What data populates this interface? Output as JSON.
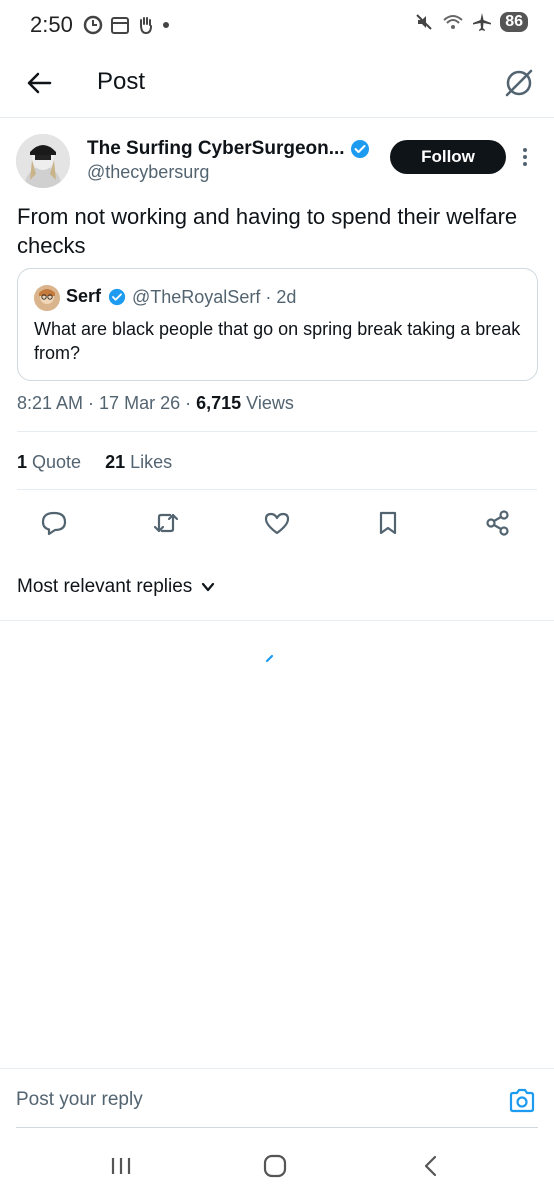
{
  "status_bar": {
    "time": "2:50",
    "battery": "86",
    "signal_label": "5"
  },
  "header": {
    "title": "Post"
  },
  "tweet": {
    "author_name": "The Surfing CyberSurgeon...",
    "author_handle": "@thecybersurg",
    "follow_label": "Follow",
    "text": "From not working and having to spend their welfare checks",
    "time": "8:21 AM",
    "date": "17 Mar 26",
    "views_count": "6,715",
    "views_label": "Views"
  },
  "quote": {
    "name": "Serf",
    "handle": "@TheRoyalSerf",
    "age": "2d",
    "text": "What are black people that go on spring break taking a break from?"
  },
  "stats": {
    "quotes_count": "1",
    "quotes_label": "Quote",
    "likes_count": "21",
    "likes_label": "Likes"
  },
  "replies": {
    "sort_label": "Most relevant replies"
  },
  "reply_bar": {
    "placeholder": "Post your reply"
  },
  "colors": {
    "accent": "#1d9bf0",
    "text": "#0f1419",
    "muted": "#536471",
    "border": "#cfd9de"
  },
  "icons": [
    "back-arrow-icon",
    "grok-icon",
    "verified-icon",
    "more-vertical-icon",
    "reply-icon",
    "repost-icon",
    "like-icon",
    "bookmark-icon",
    "share-icon",
    "chevron-down-icon",
    "camera-icon"
  ]
}
